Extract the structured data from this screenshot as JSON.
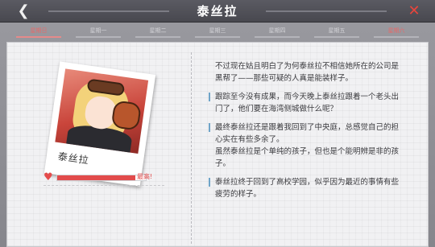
{
  "header": {
    "title": "泰丝拉",
    "back_icon": "chevron-left-icon",
    "close_icon": "close-icon"
  },
  "tabs": [
    {
      "label": "星期日",
      "active": true
    },
    {
      "label": "星期一",
      "active": false
    },
    {
      "label": "星期二",
      "active": false
    },
    {
      "label": "星期三",
      "active": false
    },
    {
      "label": "星期四",
      "active": false
    },
    {
      "label": "星期五",
      "active": false
    },
    {
      "label": "星期六",
      "active": false
    }
  ],
  "profile": {
    "name": "泰丝拉",
    "favor_label": "最高!",
    "favor_level": 0.88,
    "accent_color": "#e24b4b"
  },
  "entries": [
    {
      "text": "不过现在姑且明白了为何泰丝拉不相信她所在的公司是\n黑帮了——那些可疑的人真是能装样子。",
      "marker": false
    },
    {
      "text": "跟踪至今没有成果，而今天晚上泰丝拉跟着一个老头出\n门了，他们要在海湾侧城做什么呢？",
      "marker": true
    },
    {
      "text": "最终泰丝拉还是跟着我回到了中央庭，总感觉自己的担\n心实在有些多余了。\n虽然泰丝拉是个单纯的孩子，但也是个能明辨是非的孩\n子。",
      "marker": true
    },
    {
      "text": "泰丝拉终于回到了高校学园，似乎因为最近的事情有些\n疲劳的样子。",
      "marker": true
    }
  ]
}
